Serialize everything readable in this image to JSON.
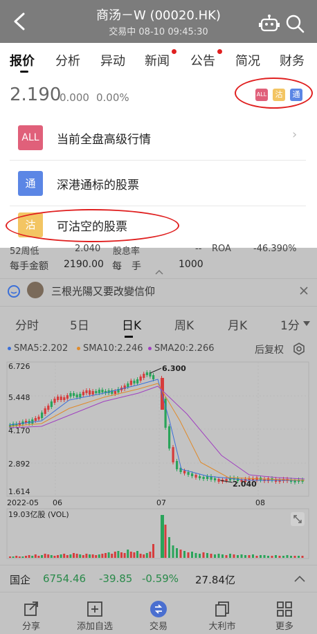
{
  "header": {
    "title": "商汤－W (00020.HK)",
    "status": "交易中 08-10 09:45:30",
    "icons": [
      "back-icon",
      "robot-icon",
      "search-icon"
    ]
  },
  "tabs": [
    {
      "label": "报价",
      "active": true
    },
    {
      "label": "分析"
    },
    {
      "label": "异动"
    },
    {
      "label": "新闻",
      "dot": true
    },
    {
      "label": "公告",
      "dot": true
    },
    {
      "label": "简况"
    },
    {
      "label": "财务"
    }
  ],
  "quote": {
    "price": "2.190",
    "change": "0.000",
    "change_pct": "0.00%",
    "badges": [
      {
        "text": "ALL",
        "color": "#e0607a"
      },
      {
        "text": "沽",
        "color": "#f3c563"
      },
      {
        "text": "通",
        "color": "#5b86e5"
      }
    ]
  },
  "menu": [
    {
      "icon_text": "ALL",
      "color": "#e0607a",
      "label": "当前全盘高级行情",
      "arrow": "›"
    },
    {
      "icon_text": "通",
      "color": "#5b86e5",
      "label": "深港通标的股票"
    },
    {
      "icon_text": "沽",
      "color": "#f3c563",
      "label": "可沽空的股票"
    }
  ],
  "stats": {
    "row1": [
      "52周低",
      "2.040",
      "股息率",
      "--",
      "ROA",
      "-46.390%"
    ],
    "lot_label": "每手金额",
    "lot_value": "2190.00",
    "per_label": "每　手",
    "per_value": "1000"
  },
  "news": {
    "text": "三根光陽又要改變信仰"
  },
  "chart_tabs": [
    {
      "label": "分时"
    },
    {
      "label": "5日"
    },
    {
      "label": "日K",
      "active": true
    },
    {
      "label": "周K"
    },
    {
      "label": "月K"
    },
    {
      "label": "1分"
    }
  ],
  "indicators": [
    {
      "label": "SMA5:2.202",
      "color": "#3b6fd8"
    },
    {
      "label": "SMA10:2.246",
      "color": "#e08a2a"
    },
    {
      "label": "SMA20:2.266",
      "color": "#a040c0"
    }
  ],
  "adjust_label": "后复权",
  "chart_data": {
    "type": "candlestick",
    "y_ticks": [
      "6.726",
      "5.448",
      "4.170",
      "2.892",
      "1.614"
    ],
    "x_ticks": [
      "2022-05",
      "06",
      "07",
      "08"
    ],
    "ylim": [
      1.614,
      6.726
    ],
    "high_label": "6.300",
    "low_label": "2.040",
    "volume_label": "19.03亿股 (VOL)"
  },
  "market_bar": {
    "name": "国企",
    "value": "6754.46",
    "change": "-39.85",
    "change_pct": "-0.59%",
    "turnover": "27.84亿"
  },
  "bottom_nav": [
    {
      "label": "分享",
      "icon": "share-icon"
    },
    {
      "label": "添加自选",
      "icon": "add-watchlist-icon"
    },
    {
      "label": "交易",
      "icon": "trade-icon"
    },
    {
      "label": "大利市",
      "icon": "copy-icon"
    },
    {
      "label": "更多",
      "icon": "more-grid-icon"
    }
  ]
}
